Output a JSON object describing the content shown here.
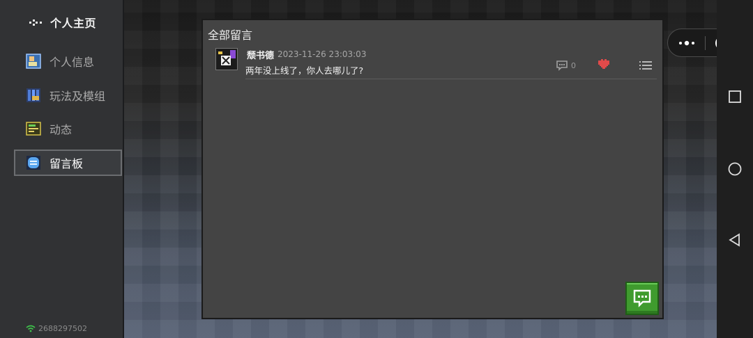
{
  "sidebar": {
    "header_title": "个人主页",
    "items": [
      {
        "label": "个人信息",
        "icon": "profile-card-icon",
        "active": false
      },
      {
        "label": "玩法及模组",
        "icon": "mods-icon",
        "active": false
      },
      {
        "label": "动态",
        "icon": "feed-icon",
        "active": false
      },
      {
        "label": "留言板",
        "icon": "message-board-icon",
        "active": true
      }
    ],
    "account_id": "2688297502"
  },
  "panel": {
    "title": "全部留言",
    "posts": [
      {
        "author": "颓书德",
        "time": "2023-11-26 23:03:03",
        "message": "两年没上线了，你人去哪儿了?",
        "reply_count": "0"
      }
    ]
  },
  "colors": {
    "accent_green": "#3f9b2e",
    "like_red": "#e04a4a",
    "panel_bg": "#444444",
    "sidebar_bg": "#313234"
  }
}
